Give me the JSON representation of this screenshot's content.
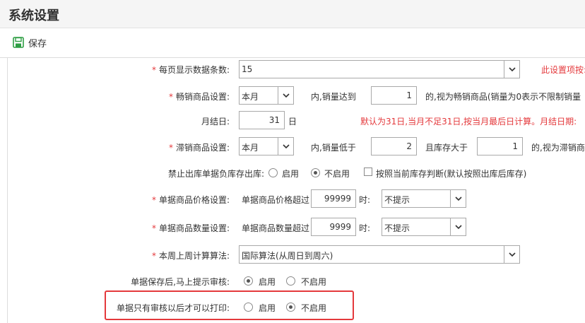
{
  "header": {
    "title": "系统设置"
  },
  "toolbar": {
    "save_label": "保存"
  },
  "rows": {
    "page_size": {
      "label": "每页显示数据条数:",
      "value": "15",
      "note": "此设置项按:"
    },
    "hot_goods": {
      "label": "畅销商品设置:",
      "period": "本月",
      "text1": "内,销量达到",
      "qty": "1",
      "text2": "的,视为畅销商品(销量为0表示不限制销量"
    },
    "month_end": {
      "label": "月结日:",
      "day": "31",
      "unit": "日",
      "note": "默认为31日,当月不足31日,按当月最后日计算。月结日期:"
    },
    "slow_goods": {
      "label": "滞销商品设置:",
      "period": "本月",
      "text1": "内,销量低于",
      "qty": "2",
      "text2": "且库存大于",
      "stock": "1",
      "text3": "的,视为滞销商"
    },
    "negative_stock": {
      "label": "禁止出库单据负库存出库:",
      "opt_on": "启用",
      "opt_off": "不启用",
      "check_label": "按照当前库存判断(默认按照出库后库存)"
    },
    "price_check": {
      "label": "单据商品价格设置:",
      "text": "单据商品价格超过",
      "value": "99999",
      "unit": "时:",
      "action": "不提示"
    },
    "qty_check": {
      "label": "单据商品数量设置:",
      "text": "单据商品数量超过",
      "value": "9999",
      "unit": "时:",
      "action": "不提示"
    },
    "week_calc": {
      "label": "本周上周计算算法:",
      "value": "国际算法(从周日到周六)"
    },
    "audit_prompt": {
      "label": "单据保存后,马上提示审核:",
      "opt_on": "启用",
      "opt_off": "不启用"
    },
    "print_after_audit": {
      "label": "单据只有审核以后才可以打印:",
      "opt_on": "启用",
      "opt_off": "不启用"
    }
  },
  "colors": {
    "required": "#e4393c",
    "highlight": "#e4393c",
    "save_icon": "#2e9e44"
  }
}
